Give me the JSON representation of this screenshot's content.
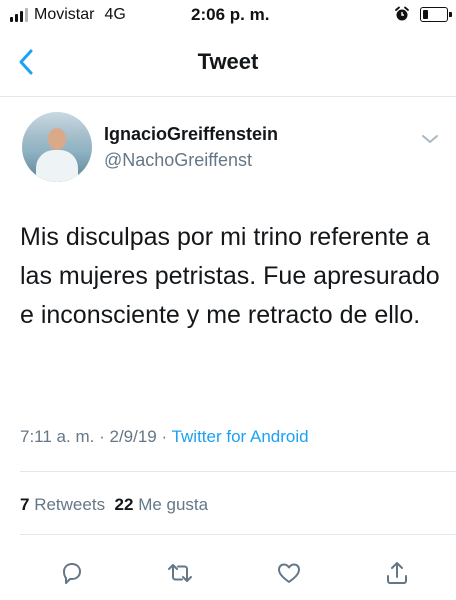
{
  "status_bar": {
    "carrier": "Movistar",
    "network": "4G",
    "time": "2:06 p. m."
  },
  "header": {
    "title": "Tweet"
  },
  "tweet": {
    "display_name": "IgnacioGreiffenstein",
    "handle": "@NachoGreiffenst",
    "text": "Mis disculpas por mi trino referente a las mujeres petristas. Fue apresurado e inconsciente y me retracto de ello.",
    "time": "7:11 a. m.",
    "date": "2/9/19",
    "separator": "·",
    "source": "Twitter for Android",
    "retweets_count": "7",
    "retweets_label": "Retweets",
    "likes_count": "22",
    "likes_label": "Me gusta"
  },
  "actions": [
    "reply-icon",
    "retweet-icon",
    "like-icon",
    "share-icon"
  ],
  "colors": {
    "accent": "#1da1f2",
    "secondary_text": "#657786",
    "primary_text": "#14171a",
    "divider": "#e1e8ed"
  }
}
